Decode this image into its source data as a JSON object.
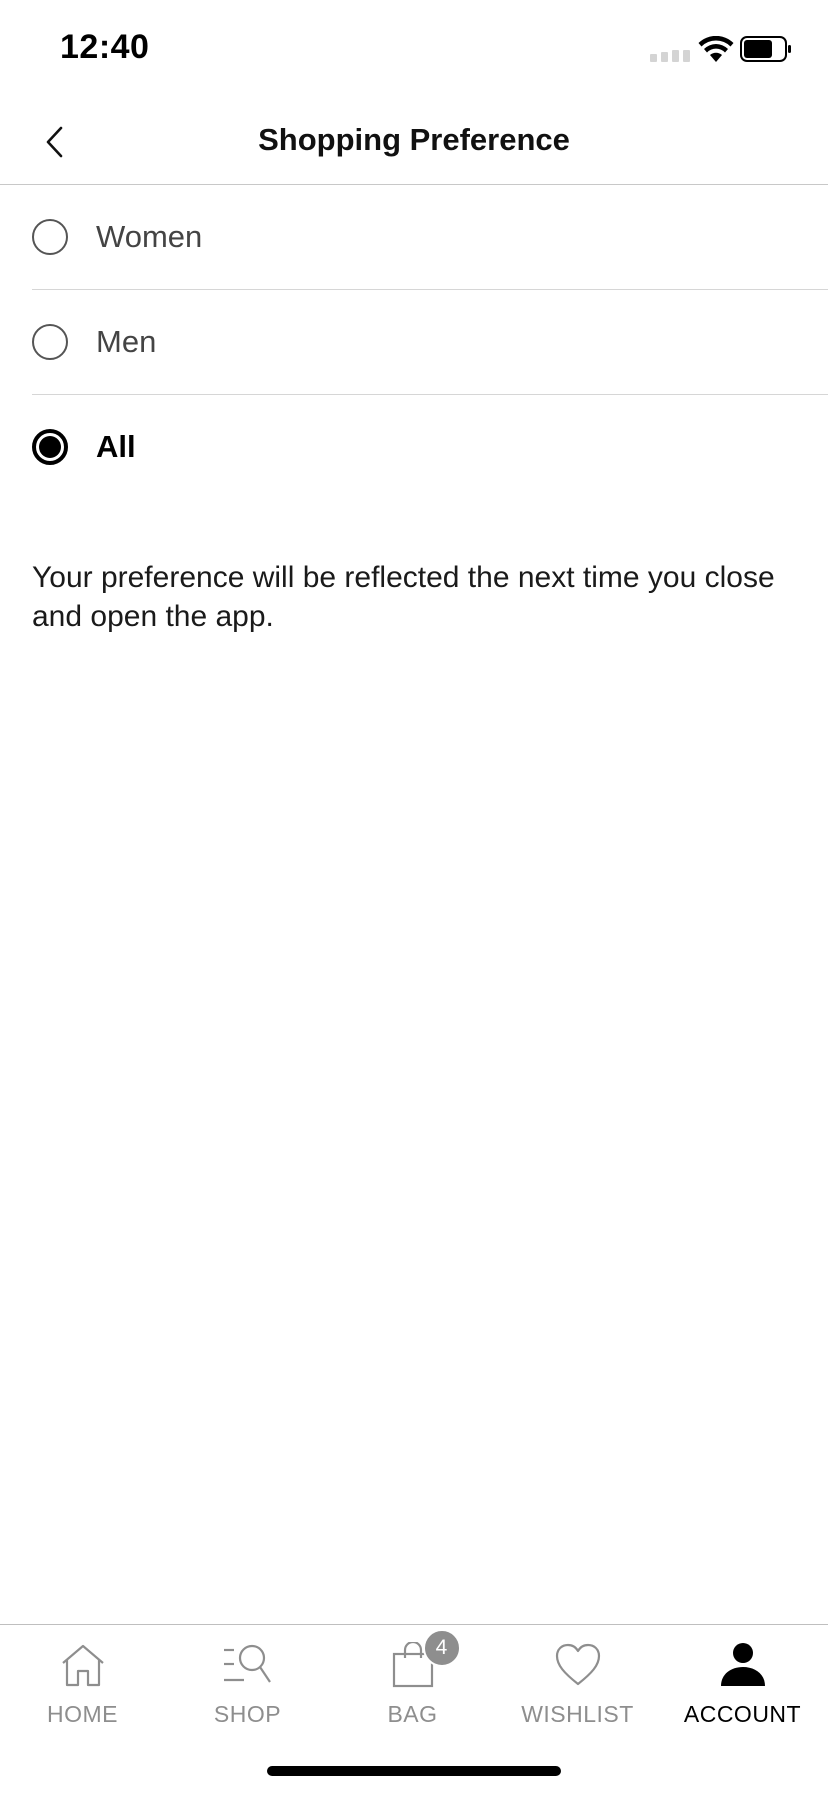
{
  "status_bar": {
    "time": "12:40",
    "signal_icon": "cellular-signal-icon",
    "wifi_icon": "wifi-icon",
    "battery_icon": "battery-icon"
  },
  "header": {
    "title": "Shopping Preference",
    "back_icon": "chevron-left-icon"
  },
  "options": [
    {
      "label": "Women",
      "selected": false
    },
    {
      "label": "Men",
      "selected": false
    },
    {
      "label": "All",
      "selected": true
    }
  ],
  "note": "Your preference will be reflected the next time you close and open the app.",
  "tab_bar": {
    "items": [
      {
        "label": "HOME",
        "icon": "home-icon",
        "active": false
      },
      {
        "label": "SHOP",
        "icon": "search-list-icon",
        "active": false
      },
      {
        "label": "BAG",
        "icon": "bag-icon",
        "active": false,
        "badge": "4"
      },
      {
        "label": "WISHLIST",
        "icon": "heart-icon",
        "active": false
      },
      {
        "label": "ACCOUNT",
        "icon": "person-icon",
        "active": true
      }
    ]
  },
  "colors": {
    "active": "#000000",
    "inactive": "#8e8e8e",
    "divider": "#d6d6d6"
  }
}
